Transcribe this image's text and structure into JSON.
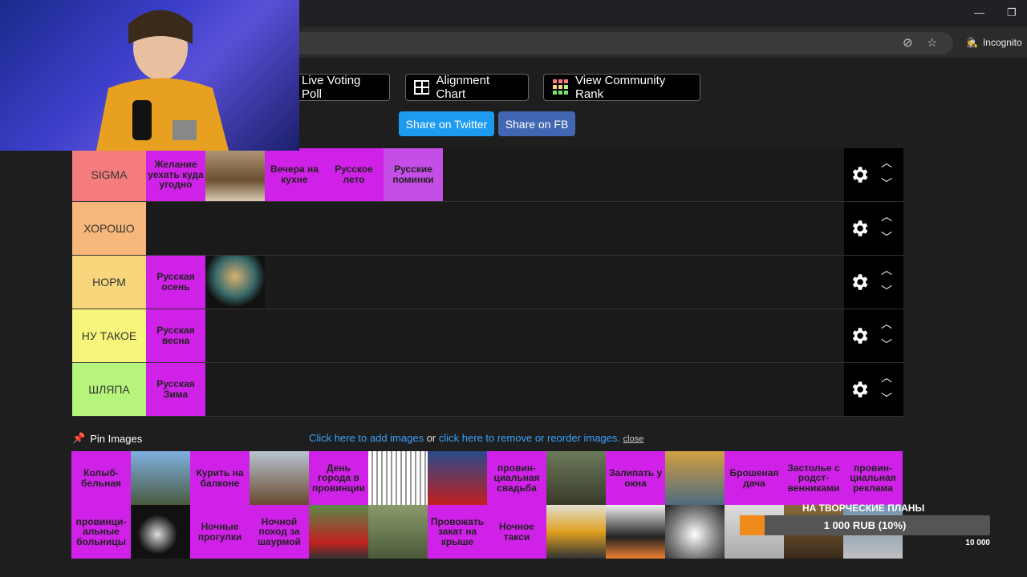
{
  "browser": {
    "incognito_label": "Incognito"
  },
  "toolbar": {
    "live_voting": "Live Voting Poll",
    "alignment": "Alignment Chart",
    "community_rank": "View Community Rank",
    "share_twitter": "Share on Twitter",
    "share_fb": "Share on FB"
  },
  "colors": {
    "sigma": "#f47c7c",
    "good": "#f7b77a",
    "norm": "#f8d67c",
    "meh": "#f8f57c",
    "hat": "#b6f47c",
    "tile": "#d021e8",
    "twitter": "#1d9bf0",
    "fb": "#4267b2"
  },
  "tiers": [
    {
      "label": "SIGMA",
      "items": [
        "Желание уехать куда угодно",
        "[img]",
        "Вечера на кухне",
        "Русское лето",
        "Русские поминки"
      ]
    },
    {
      "label": "ХОРОШО",
      "items": []
    },
    {
      "label": "НОРМ",
      "items": [
        "Русская осень",
        "[img]"
      ]
    },
    {
      "label": "НУ ТАКОЕ",
      "items": [
        "Русская весна"
      ]
    },
    {
      "label": "ШЛЯПА",
      "items": [
        "Русская Зима"
      ]
    }
  ],
  "pin": {
    "label": "Pin Images",
    "add_link": "Click here to add images",
    "or": "or",
    "remove_link": "click here to remove or reorder images.",
    "close": "close"
  },
  "pool": [
    "Колыб-бельная",
    "[img]",
    "Курить на балконе",
    "[img]",
    "День города в провинции",
    "[img]",
    "[img]",
    "провин-циальная свадьба",
    "[img]",
    "Залипать у окна",
    "[img]",
    "Брошеная дача",
    "Застолье с родст-венниками",
    "провин-циальная реклама",
    "провинци-альные больницы",
    "[img]",
    "Ночные прогулки",
    "Ночной поход за шаурмой",
    "[img]",
    "[img]",
    "Провожать закат на крыше",
    "Ночное такси",
    "[img]",
    "[img]",
    "[img]",
    "[img]",
    "[img]",
    "[img]"
  ],
  "donation": {
    "title": "НА ТВОРЧЕСКИЕ ПЛАНЫ",
    "amount": "1 000 RUB (10%)",
    "goal": "10 000",
    "progress": 0.1
  }
}
